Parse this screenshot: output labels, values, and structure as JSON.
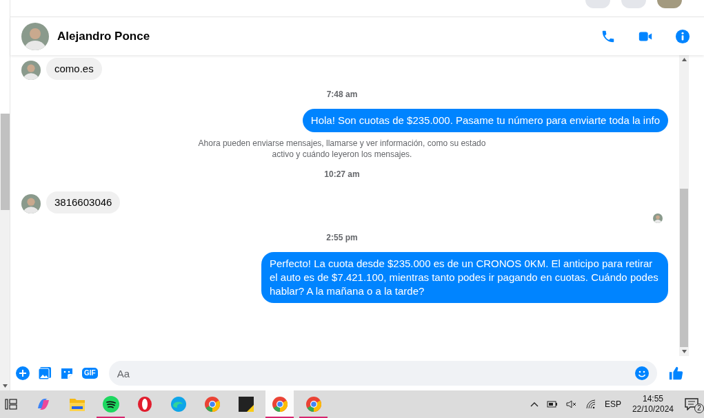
{
  "chat": {
    "contact_name": "Alejandro Ponce"
  },
  "messages": [
    {
      "kind": "incoming",
      "text": "como.es"
    },
    {
      "kind": "time",
      "text": "7:48 am"
    },
    {
      "kind": "outgoing",
      "text": "Hola! Son cuotas de $235.000. Pasame tu número para enviarte toda la info"
    },
    {
      "kind": "notice",
      "text": "Ahora pueden enviarse mensajes, llamarse y ver información, como su estado activo y cuándo leyeron los mensajes."
    },
    {
      "kind": "time",
      "text": "10:27 am"
    },
    {
      "kind": "incoming",
      "text": "3816603046"
    },
    {
      "kind": "seen"
    },
    {
      "kind": "time",
      "text": "2:55 pm"
    },
    {
      "kind": "outgoing",
      "text": "Perfecto! La cuota desde $235.000 es de un CRONOS 0KM. El anticipo para retirar el auto es de $7.421.100, mientras tanto podes ir pagando en cuotas. Cuándo podes hablar? A la mañana o a la tarde?"
    }
  ],
  "composer": {
    "placeholder": "Aa",
    "gif_label": "GIF"
  },
  "taskbar": {
    "apps": [
      {
        "kind": "copilot",
        "open": false,
        "selected": false
      },
      {
        "kind": "folder",
        "open": false,
        "selected": false
      },
      {
        "kind": "spotify",
        "open": true,
        "selected": false
      },
      {
        "kind": "opera",
        "open": false,
        "selected": false
      },
      {
        "kind": "edge",
        "open": false,
        "selected": false
      },
      {
        "kind": "chrome",
        "open": false,
        "selected": false
      },
      {
        "kind": "notes",
        "open": false,
        "selected": false
      },
      {
        "kind": "chrome",
        "open": true,
        "selected": true
      },
      {
        "kind": "chrome",
        "open": true,
        "selected": false
      }
    ],
    "language": "ESP",
    "time": "14:55",
    "date": "22/10/2024",
    "notifications": "2"
  }
}
